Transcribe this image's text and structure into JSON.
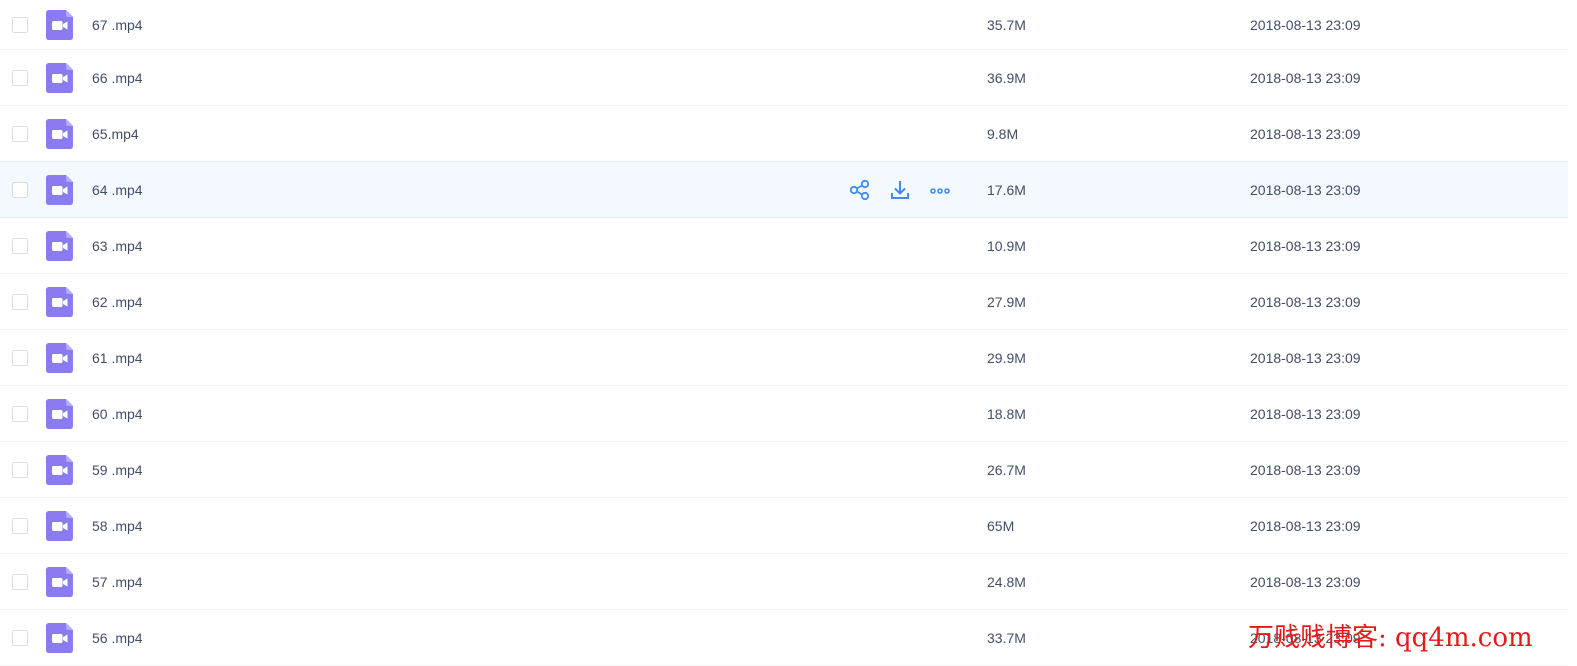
{
  "files": [
    {
      "name": "67 .mp4",
      "size": "35.7M",
      "date": "2018-08-13 23:09"
    },
    {
      "name": "66 .mp4",
      "size": "36.9M",
      "date": "2018-08-13 23:09"
    },
    {
      "name": "65.mp4",
      "size": "9.8M",
      "date": "2018-08-13 23:09"
    },
    {
      "name": "64 .mp4",
      "size": "17.6M",
      "date": "2018-08-13 23:09"
    },
    {
      "name": "63 .mp4",
      "size": "10.9M",
      "date": "2018-08-13 23:09"
    },
    {
      "name": "62 .mp4",
      "size": "27.9M",
      "date": "2018-08-13 23:09"
    },
    {
      "name": "61 .mp4",
      "size": "29.9M",
      "date": "2018-08-13 23:09"
    },
    {
      "name": "60 .mp4",
      "size": "18.8M",
      "date": "2018-08-13 23:09"
    },
    {
      "name": "59 .mp4",
      "size": "26.7M",
      "date": "2018-08-13 23:09"
    },
    {
      "name": "58 .mp4",
      "size": "65M",
      "date": "2018-08-13 23:09"
    },
    {
      "name": "57 .mp4",
      "size": "24.8M",
      "date": "2018-08-13 23:09"
    },
    {
      "name": "56 .mp4",
      "size": "33.7M",
      "date": "2018-08-13 23:09"
    }
  ],
  "hover_row_index": 3,
  "icons": {
    "file": "video-file-icon",
    "share": "share-icon",
    "download": "download-icon",
    "more": "more-icon"
  },
  "colors": {
    "file_icon": "#8a7cf0",
    "action_icon": "#3b8cf5",
    "hover_background": "#f4f8ff",
    "watermark": "#e8191b"
  },
  "watermark": "万贱贱博客: qq4m.com"
}
